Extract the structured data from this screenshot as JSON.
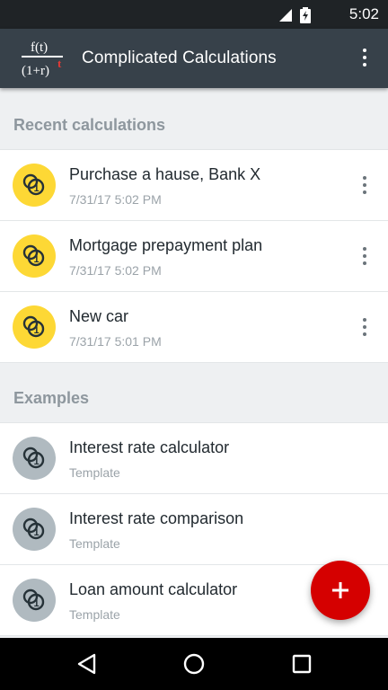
{
  "status_bar": {
    "time": "5:02"
  },
  "app_bar": {
    "title": "Complicated Calculations",
    "logo_text_top": "f(t)",
    "logo_text_bottom": "(1+r)",
    "logo_exp": "t"
  },
  "recent": {
    "header": "Recent calculations",
    "items": [
      {
        "title": "Purchase a hause, Bank X",
        "subtitle": "7/31/17 5:02 PM"
      },
      {
        "title": "Mortgage prepayment plan",
        "subtitle": "7/31/17 5:02 PM"
      },
      {
        "title": "New car",
        "subtitle": "7/31/17 5:01 PM"
      }
    ]
  },
  "examples": {
    "header": "Examples",
    "items": [
      {
        "title": "Interest rate calculator",
        "subtitle": "Template"
      },
      {
        "title": "Interest rate comparison",
        "subtitle": "Template"
      },
      {
        "title": "Loan amount calculator",
        "subtitle": "Template"
      }
    ]
  },
  "colors": {
    "app_bar": "#37414a",
    "recent_avatar": "#fdd835",
    "example_avatar": "#b0bac0",
    "fab": "#d50000",
    "logo_accent": "#e53935"
  },
  "icons": {
    "coins": "coins-icon",
    "more": "more-vert-icon",
    "add": "plus-icon"
  }
}
